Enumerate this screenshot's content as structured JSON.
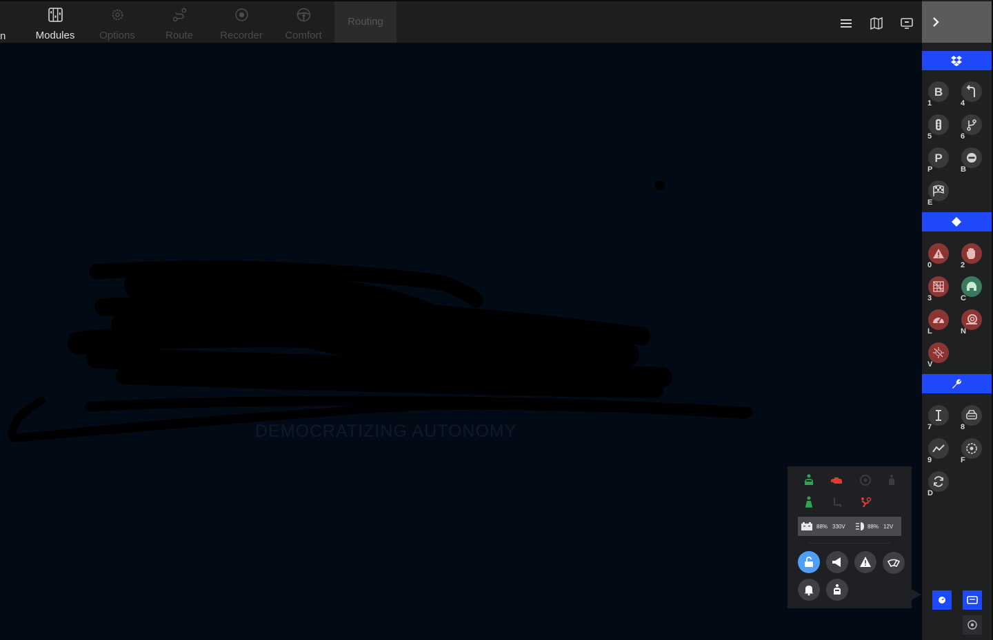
{
  "topbar": {
    "cut_label": "n",
    "tabs": [
      {
        "label": "Modules",
        "icon": "modules-icon",
        "active": true
      },
      {
        "label": "Options",
        "icon": "gear-icon",
        "active": false
      },
      {
        "label": "Route",
        "icon": "route-icon",
        "active": false
      },
      {
        "label": "Recorder",
        "icon": "record-icon",
        "active": false
      },
      {
        "label": "Comfort",
        "icon": "steering-wheel-icon",
        "active": false
      }
    ],
    "routing_tab": {
      "label": "Routing"
    },
    "right_icons": [
      "menu-icon",
      "map-icon",
      "screen-icon"
    ]
  },
  "main": {
    "tagline": "DEMOCRATIZING AUTONOMY"
  },
  "right_panel": {
    "collapse_icon": "chevron-right-icon",
    "sections": [
      {
        "icon": "dropbox-icon",
        "buttons": [
          {
            "key": "1",
            "icon": "b-icon"
          },
          {
            "key": "4",
            "icon": "turn-icon"
          },
          {
            "key": "5",
            "icon": "traffic-light-icon"
          },
          {
            "key": "6",
            "icon": "fork-icon"
          },
          {
            "key": "P",
            "icon": "parking-icon"
          },
          {
            "key": "B",
            "icon": "no-entry-icon"
          },
          {
            "key": "E",
            "icon": "checkered-flag-icon"
          }
        ]
      },
      {
        "icon": "diamond-icon",
        "buttons": [
          {
            "key": "0",
            "icon": "warning-icon",
            "color": "red"
          },
          {
            "key": "2",
            "icon": "hand-stop-icon",
            "color": "red"
          },
          {
            "key": "3",
            "icon": "grid-icon",
            "color": "red"
          },
          {
            "key": "C",
            "icon": "car-icon",
            "color": "green"
          },
          {
            "key": "L",
            "icon": "speedometer-icon",
            "color": "red"
          },
          {
            "key": "N",
            "icon": "snail-icon",
            "color": "red"
          },
          {
            "key": "V",
            "icon": "virus-icon",
            "color": "red"
          }
        ]
      },
      {
        "icon": "wrench-icon",
        "buttons": [
          {
            "key": "7",
            "icon": "lift-icon"
          },
          {
            "key": "8",
            "icon": "vehicle-front-icon"
          },
          {
            "key": "9",
            "icon": "chart-line-icon"
          },
          {
            "key": "F",
            "icon": "target-icon"
          },
          {
            "key": "D",
            "icon": "refresh-icon"
          }
        ]
      }
    ],
    "bottom_buttons": [
      "gauge-icon",
      "message-icon",
      "record-dot-icon"
    ]
  },
  "status_card": {
    "indicators": [
      {
        "icon": "driver-icon",
        "color": "#2fa34d"
      },
      {
        "icon": "engine-icon",
        "color": "#e03a32"
      },
      {
        "icon": "steering-wheel-icon",
        "color": "#3b3c40"
      },
      {
        "icon": "seatbelt-icon",
        "color": "#3b3c40"
      },
      {
        "icon": "passenger-icon",
        "color": "#2fa34d"
      },
      {
        "icon": "seat-icon",
        "color": "#3b3c40"
      },
      {
        "icon": "airbag-icon",
        "color": "#e03a32"
      }
    ],
    "hv_battery": {
      "percent": "88%",
      "voltage": "330V"
    },
    "lv_battery": {
      "percent": "88%",
      "voltage": "12V"
    },
    "controls": [
      "unlock-icon",
      "horn-icon",
      "hazard-icon",
      "wiper-icon",
      "bell-icon",
      "door-icon"
    ]
  },
  "colors": {
    "accent_blue": "#1f48f8",
    "topbar": "#1e1e1f",
    "background": "#020a16",
    "active_lock": "#4f9ef8"
  }
}
